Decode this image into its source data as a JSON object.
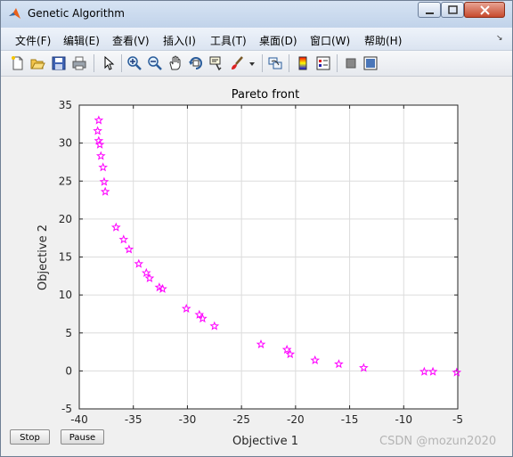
{
  "window": {
    "title": "Genetic Algorithm"
  },
  "menu": [
    "文件(F)",
    "编辑(E)",
    "查看(V)",
    "插入(I)",
    "工具(T)",
    "桌面(D)",
    "窗口(W)",
    "帮助(H)"
  ],
  "toolbar_icons": [
    "new-figure-icon",
    "open-file-icon",
    "save-icon",
    "print-icon",
    "select-arrow-icon",
    "zoom-in-icon",
    "zoom-out-icon",
    "pan-hand-icon",
    "rotate-3d-icon",
    "data-cursor-icon",
    "brush-icon",
    "brush-dropdown-icon",
    "link-plot-icon",
    "colorbar-icon",
    "legend-icon",
    "hide-plot-tools-icon",
    "show-plot-tools-icon"
  ],
  "chart_data": {
    "type": "scatter",
    "title": "Pareto front",
    "xlabel": "Objective 1",
    "ylabel": "Objective 2",
    "xlim": [
      -40,
      -5
    ],
    "ylim": [
      -5,
      35
    ],
    "xticks": [
      -40,
      -35,
      -30,
      -25,
      -20,
      -15,
      -10,
      -5
    ],
    "yticks": [
      -5,
      0,
      5,
      10,
      15,
      20,
      25,
      30,
      35
    ],
    "xtick_labels": [
      "-40",
      "-35",
      "-30",
      "-25",
      "-20",
      "-15",
      "-10",
      "-5"
    ],
    "ytick_labels": [
      "-5",
      "0",
      "5",
      "10",
      "15",
      "20",
      "25",
      "30",
      "35"
    ],
    "grid": true,
    "marker": "pentagram",
    "marker_color": "#ff00ff",
    "points": [
      {
        "x": -38.2,
        "y": 33.0
      },
      {
        "x": -38.3,
        "y": 31.6
      },
      {
        "x": -38.2,
        "y": 30.3
      },
      {
        "x": -38.1,
        "y": 29.8
      },
      {
        "x": -38.0,
        "y": 28.3
      },
      {
        "x": -37.8,
        "y": 26.8
      },
      {
        "x": -37.7,
        "y": 24.9
      },
      {
        "x": -37.6,
        "y": 23.6
      },
      {
        "x": -36.6,
        "y": 18.9
      },
      {
        "x": -35.9,
        "y": 17.3
      },
      {
        "x": -35.4,
        "y": 16.0
      },
      {
        "x": -34.5,
        "y": 14.1
      },
      {
        "x": -33.8,
        "y": 12.9
      },
      {
        "x": -33.5,
        "y": 12.2
      },
      {
        "x": -32.6,
        "y": 11.0
      },
      {
        "x": -32.3,
        "y": 10.8
      },
      {
        "x": -30.1,
        "y": 8.2
      },
      {
        "x": -28.9,
        "y": 7.4
      },
      {
        "x": -28.6,
        "y": 6.9
      },
      {
        "x": -27.5,
        "y": 5.9
      },
      {
        "x": -23.2,
        "y": 3.5
      },
      {
        "x": -20.8,
        "y": 2.8
      },
      {
        "x": -20.5,
        "y": 2.2
      },
      {
        "x": -18.2,
        "y": 1.4
      },
      {
        "x": -16.0,
        "y": 0.9
      },
      {
        "x": -13.7,
        "y": 0.4
      },
      {
        "x": -8.1,
        "y": -0.1
      },
      {
        "x": -7.3,
        "y": -0.1
      },
      {
        "x": -5.1,
        "y": -0.2
      }
    ]
  },
  "buttons": {
    "stop": "Stop",
    "pause": "Pause"
  },
  "watermark": "CSDN @mozun2020"
}
